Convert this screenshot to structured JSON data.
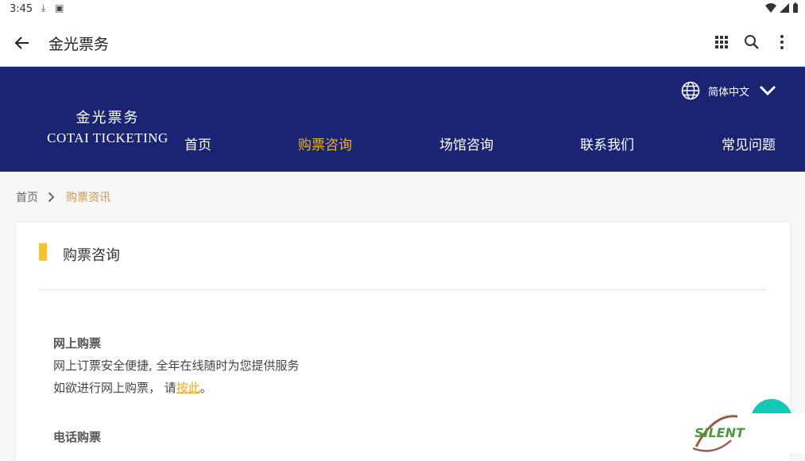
{
  "status_bar": {
    "time": "3:45",
    "left_icons": [
      "download-icon",
      "a-icon"
    ],
    "right_icons": [
      "wifi-icon",
      "signal-icon",
      "battery-icon"
    ]
  },
  "app_bar": {
    "title": "金光票务",
    "actions": [
      "apps-grid-icon",
      "search-icon",
      "more-vert-icon"
    ]
  },
  "site_header": {
    "brand_zh": "金光票务",
    "brand_en": "COTAI TICKETING",
    "language": "简体中文",
    "background": "#1b2473",
    "accent": "#f0b323",
    "nav": [
      {
        "label": "首页",
        "active": false
      },
      {
        "label": "购票咨询",
        "active": true
      },
      {
        "label": "场馆咨询",
        "active": false
      },
      {
        "label": "联系我们",
        "active": false
      },
      {
        "label": "常见问题",
        "active": false
      }
    ]
  },
  "breadcrumb": {
    "home": "首页",
    "current": "购票资讯"
  },
  "content": {
    "section_title": "购票咨询",
    "online": {
      "heading": "网上购票",
      "line1": "网上订票安全便捷, 全年在线随时为您提供服务",
      "line2_prefix": "如欲进行网上购票， 请",
      "link": "按此",
      "line2_suffix": "。"
    },
    "phone": {
      "heading": "电话购票"
    }
  },
  "watermark": "SILENT"
}
